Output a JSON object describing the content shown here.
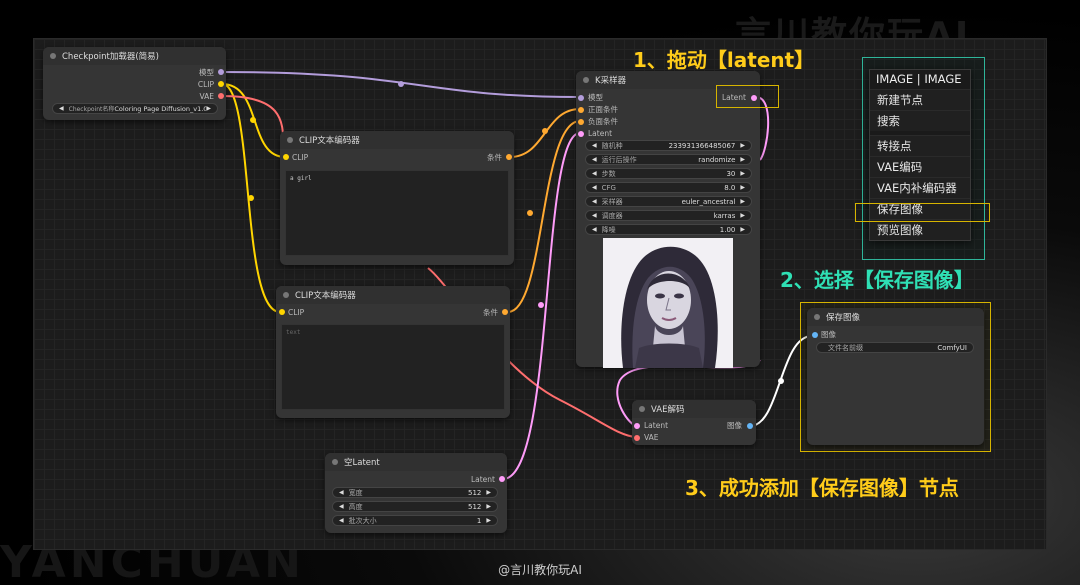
{
  "backdrop": {
    "watermark_top": "言川教你玩AI",
    "watermark_bottom": "YANCHUAN",
    "credit": "@言川教你玩AI"
  },
  "nodes": {
    "checkpoint": {
      "title": "Checkpoint加载器(简易)",
      "outputs": [
        "模型",
        "CLIP",
        "VAE"
      ],
      "ckpt_label": "Checkpoint名称",
      "ckpt_value": "Coloring Page Diffusion_v1.0.ckpt"
    },
    "clip_pos": {
      "title": "CLIP文本编码器",
      "input": "CLIP",
      "output": "条件",
      "text": "a girl"
    },
    "clip_neg": {
      "title": "CLIP文本编码器",
      "input": "CLIP",
      "output": "条件",
      "text": "text"
    },
    "ksampler": {
      "title": "K采样器",
      "inputs": [
        "模型",
        "正面条件",
        "负面条件",
        "Latent"
      ],
      "output": "Latent",
      "widgets": [
        {
          "label": "随机种",
          "value": "233931366485067"
        },
        {
          "label": "运行后操作",
          "value": "randomize"
        },
        {
          "label": "步数",
          "value": "30"
        },
        {
          "label": "CFG",
          "value": "8.0"
        },
        {
          "label": "采样器",
          "value": "euler_ancestral"
        },
        {
          "label": "调度器",
          "value": "karras"
        },
        {
          "label": "降噪",
          "value": "1.00"
        }
      ]
    },
    "vae_decode": {
      "title": "VAE解码",
      "inputs": [
        "Latent",
        "VAE"
      ],
      "output": "图像"
    },
    "empty_latent": {
      "title": "空Latent",
      "output": "Latent",
      "widgets": [
        {
          "label": "宽度",
          "value": "512"
        },
        {
          "label": "高度",
          "value": "512"
        },
        {
          "label": "批次大小",
          "value": "1"
        }
      ]
    },
    "save_image": {
      "title": "保存图像",
      "input": "图像",
      "widget_label": "文件名前缀",
      "widget_value": "ComfyUI"
    }
  },
  "menu": {
    "title": "IMAGE | IMAGE",
    "items": [
      "新建节点",
      "搜索",
      "转接点",
      "VAE编码",
      "VAE内补编码器",
      "保存图像",
      "预览图像"
    ],
    "highlighted": "保存图像"
  },
  "annotations": {
    "step1": "1、拖动【latent】",
    "step2": "2、选择【保存图像】",
    "step3": "3、成功添加【保存图像】节点"
  },
  "colors": {
    "model_wire": "#b39ddb",
    "clip_wire": "#ffd500",
    "vae_wire": "#ff6e6e",
    "conditioning_wire": "#ffa931",
    "latent_wire": "#ff9cf9",
    "image_wire": "#64b5f6",
    "annotation_yellow": "#ffcc1a",
    "annotation_green": "#2fe0b5",
    "menu_outline": "#2fb59a"
  }
}
